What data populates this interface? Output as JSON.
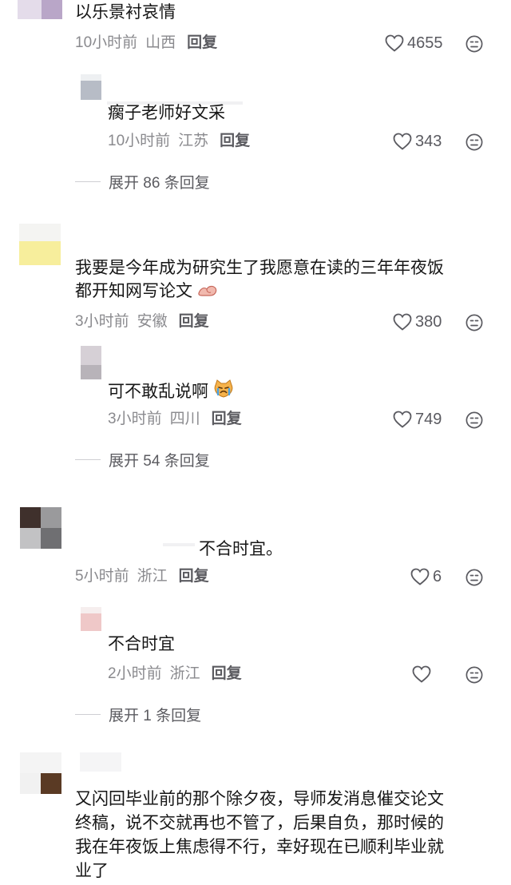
{
  "comments": [
    {
      "id": "c1",
      "text": "以乐景衬哀情",
      "time": "10小时前",
      "location": "山西",
      "reply_label": "回复",
      "likes": "4655",
      "replies": [
        {
          "text": "瘸子老师好文采",
          "time": "10小时前",
          "location": "江苏",
          "reply_label": "回复",
          "likes": "343"
        }
      ],
      "expand_label": "展开 86 条回复"
    },
    {
      "id": "c2",
      "text_line1": "我要是今年成为研究生了我愿意在读的三年年夜饭",
      "text_line2": "都开知网写论文",
      "text_line2_emoji": "muscle-emoji",
      "time": "3小时前",
      "location": "安徽",
      "reply_label": "回复",
      "likes": "380",
      "replies": [
        {
          "text": "可不敢乱说啊",
          "text_emoji": "crying-cat-emoji",
          "time": "3小时前",
          "location": "四川",
          "reply_label": "回复",
          "likes": "749"
        }
      ],
      "expand_label": "展开 54 条回复"
    },
    {
      "id": "c3",
      "text": "不合时宜。",
      "time": "5小时前",
      "location": "浙江",
      "reply_label": "回复",
      "likes": "6",
      "replies": [
        {
          "text": "不合时宜",
          "time": "2小时前",
          "location": "浙江",
          "reply_label": "回复",
          "likes": ""
        }
      ],
      "expand_label": "展开 1 条回复"
    },
    {
      "id": "c4",
      "text_lines": [
        "又闪回毕业前的那个除夕夜，导师发消息催交论文",
        "终稿，说不交就再也不管了，后果自负，那时候的",
        "我在年夜饭上焦虑得不行，幸好现在已顺利毕业就",
        "业了"
      ]
    }
  ],
  "colors": {
    "text": "#161616",
    "meta": "#8a8a8e",
    "reply": "#5b5b60",
    "icon": "#5a5a60"
  }
}
